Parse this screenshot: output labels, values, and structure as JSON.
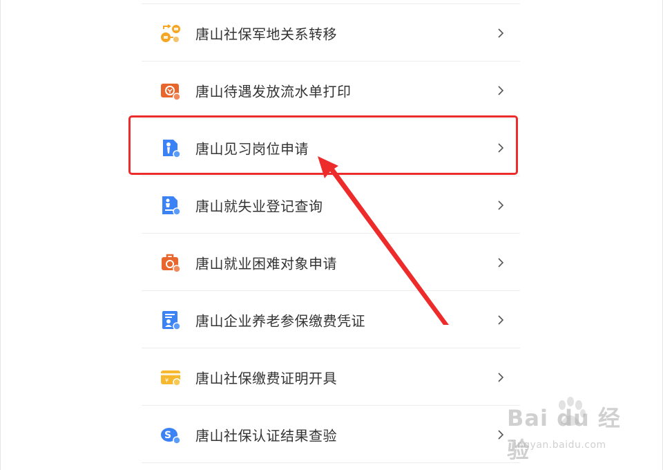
{
  "list": {
    "items": [
      {
        "label": "唐山社保军地关系转移",
        "icon": "military-transfer-icon",
        "color": "#f5a623"
      },
      {
        "label": "唐山待遇发放流水单打印",
        "icon": "payment-record-icon",
        "color": "#e8652b"
      },
      {
        "label": "唐山见习岗位申请",
        "icon": "internship-icon",
        "color": "#3b82f6"
      },
      {
        "label": "唐山就失业登记查询",
        "icon": "employment-registration-icon",
        "color": "#3b82f6"
      },
      {
        "label": "唐山就业困难对象申请",
        "icon": "briefcase-icon",
        "color": "#e8652b"
      },
      {
        "label": "唐山企业养老参保缴费凭证",
        "icon": "pension-certificate-icon",
        "color": "#3b82f6"
      },
      {
        "label": "唐山社保缴费证明开具",
        "icon": "payment-card-icon",
        "color": "#f5b82e"
      },
      {
        "label": "唐山社保认证结果查验",
        "icon": "social-security-icon",
        "color": "#3b82f6"
      }
    ],
    "chevron": "›"
  },
  "annotation": {
    "highlight_color": "#ee2b2b",
    "highlighted_item": "唐山见习岗位申请"
  },
  "watermark": {
    "brand": "Bai du 经验",
    "url": "jingyan.baidu.com"
  }
}
